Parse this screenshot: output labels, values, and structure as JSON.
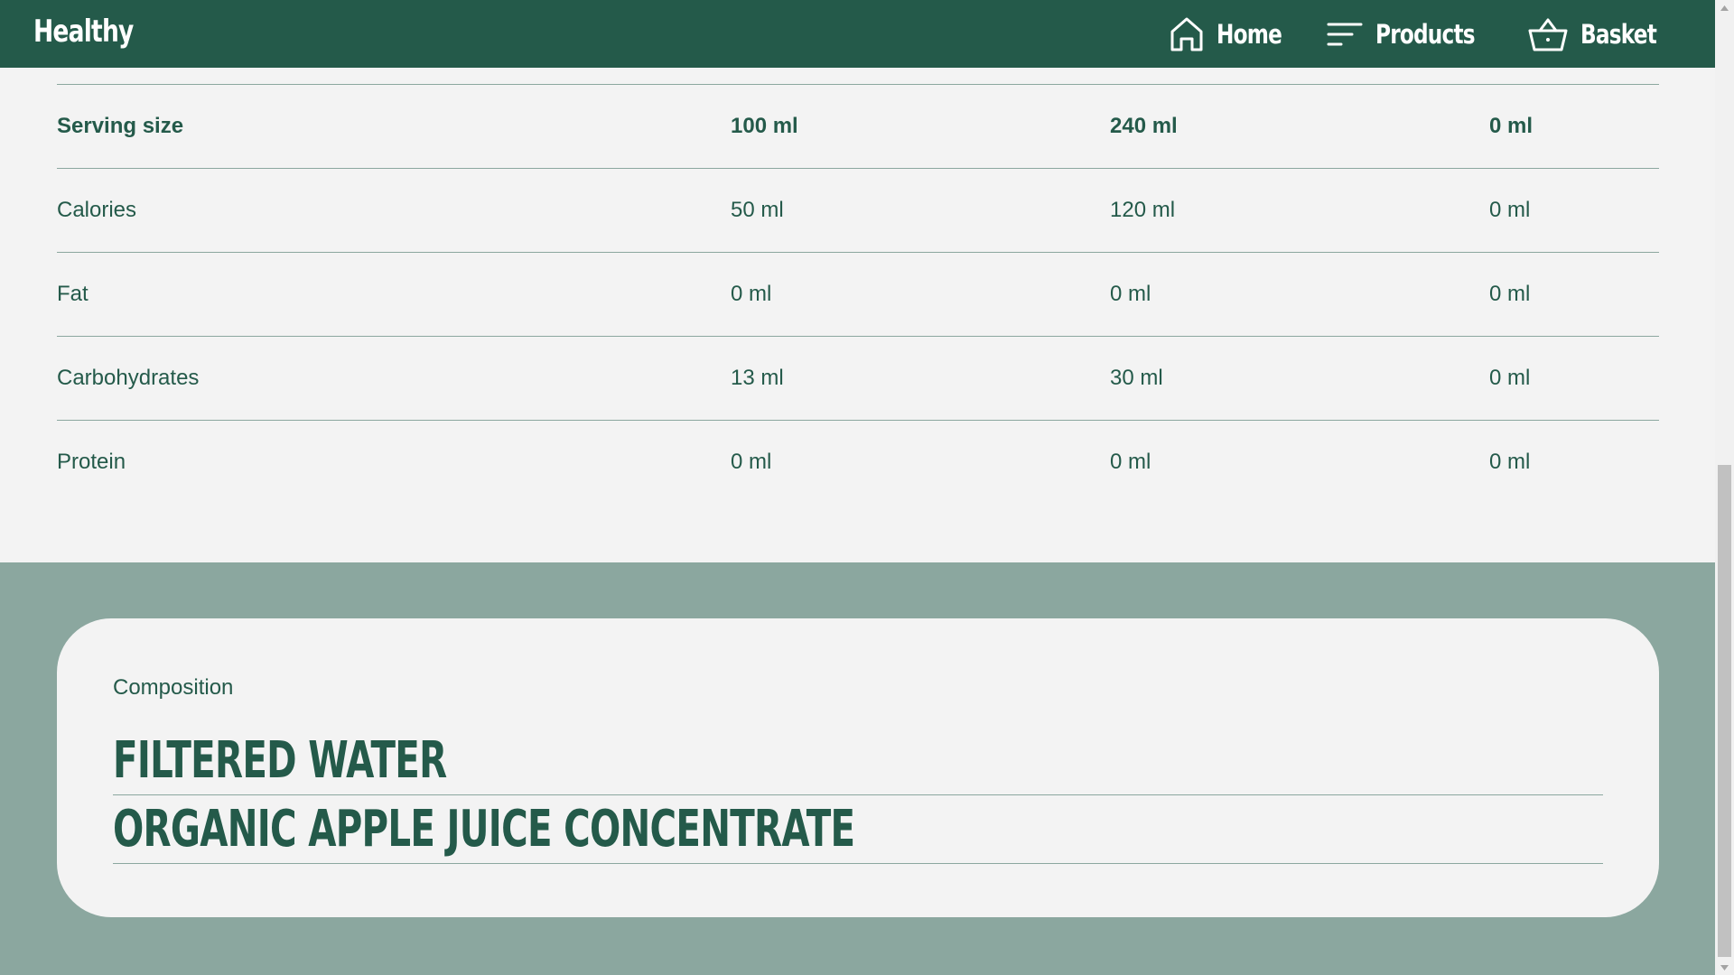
{
  "header": {
    "brand": "Healthy",
    "nav": [
      {
        "label": "Home",
        "icon": "home-icon"
      },
      {
        "label": "Products",
        "icon": "menu-lines-icon"
      },
      {
        "label": "Basket",
        "icon": "basket-icon"
      }
    ]
  },
  "nutrition_table": {
    "rows": [
      {
        "name": "Serving size",
        "values": [
          "100 ml",
          "240 ml",
          "0 ml"
        ]
      },
      {
        "name": "Calories",
        "values": [
          "50 ml",
          "120 ml",
          "0 ml"
        ]
      },
      {
        "name": "Fat",
        "values": [
          "0 ml",
          "0 ml",
          "0 ml"
        ]
      },
      {
        "name": "Carbohydrates",
        "values": [
          "13 ml",
          "30 ml",
          "0 ml"
        ]
      },
      {
        "name": "Protein",
        "values": [
          "0 ml",
          "0 ml",
          "0 ml"
        ]
      }
    ]
  },
  "composition": {
    "title": "Composition",
    "items": [
      "FILTERED WATER",
      "ORGANIC APPLE JUICE CONCENTRATE"
    ]
  },
  "colors": {
    "primary": "#245a4a",
    "background": "#f3f3f3",
    "section_bg": "#8ba79f",
    "divider": "#8ba79f"
  }
}
